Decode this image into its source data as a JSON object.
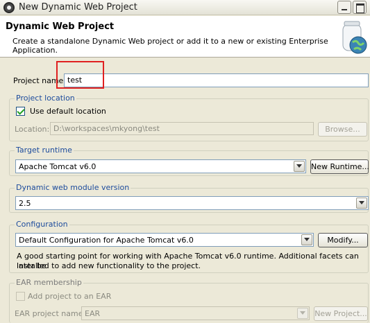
{
  "window": {
    "title": "New Dynamic Web Project"
  },
  "header": {
    "title": "Dynamic Web Project",
    "description": "Create a standalone Dynamic Web project or add it to a new or existing Enterprise Application."
  },
  "project_name": {
    "label": "Project name:",
    "value": "test"
  },
  "project_location": {
    "legend": "Project location",
    "use_default_label": "Use default location",
    "use_default_checked": true,
    "location_label": "Location:",
    "location_value": "D:\\workspaces\\mkyong\\test",
    "browse_label": "Browse..."
  },
  "target_runtime": {
    "legend": "Target runtime",
    "selected": "Apache Tomcat v6.0",
    "new_runtime_label": "New Runtime..."
  },
  "module_version": {
    "legend": "Dynamic web module version",
    "selected": "2.5"
  },
  "configuration": {
    "legend": "Configuration",
    "selected": "Default Configuration for Apache Tomcat v6.0",
    "modify_label": "Modify...",
    "note_line1": "A good starting point for working with Apache Tomcat v6.0 runtime. Additional facets can later be",
    "note_line2": "installed to add new functionality to the project."
  },
  "ear_membership": {
    "legend": "EAR membership",
    "add_label": "Add project to an EAR",
    "add_checked": false,
    "ear_name_label": "EAR project name:",
    "ear_name_value": "EAR",
    "new_project_label": "New Project..."
  }
}
